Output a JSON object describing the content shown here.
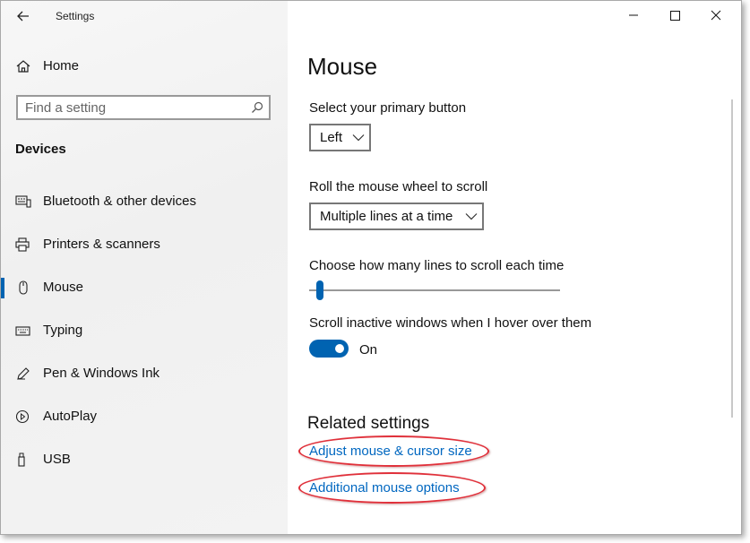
{
  "window": {
    "title": "Settings",
    "controls": {
      "minimize": "minimize-icon",
      "maximize": "maximize-icon",
      "close": "close-icon"
    }
  },
  "sidebar": {
    "home_label": "Home",
    "search": {
      "placeholder": "Find a setting",
      "value": ""
    },
    "section_heading": "Devices",
    "items": [
      {
        "label": "Bluetooth & other devices",
        "icon": "bluetooth-devices-icon",
        "selected": false
      },
      {
        "label": "Printers & scanners",
        "icon": "printer-icon",
        "selected": false
      },
      {
        "label": "Mouse",
        "icon": "mouse-icon",
        "selected": true
      },
      {
        "label": "Typing",
        "icon": "keyboard-icon",
        "selected": false
      },
      {
        "label": "Pen & Windows Ink",
        "icon": "pen-icon",
        "selected": false
      },
      {
        "label": "AutoPlay",
        "icon": "autoplay-icon",
        "selected": false
      },
      {
        "label": "USB",
        "icon": "usb-icon",
        "selected": false
      }
    ]
  },
  "main": {
    "title": "Mouse",
    "primary_button": {
      "label": "Select your primary button",
      "value": "Left"
    },
    "scroll_wheel": {
      "label": "Roll the mouse wheel to scroll",
      "value": "Multiple lines at a time"
    },
    "lines_to_scroll": {
      "label": "Choose how many lines to scroll each time",
      "slider_fraction": 0.03
    },
    "inactive_scroll": {
      "label": "Scroll inactive windows when I hover over them",
      "state": "On",
      "on": true
    },
    "related": {
      "heading": "Related settings",
      "links": [
        "Adjust mouse & cursor size",
        "Additional mouse options"
      ]
    }
  },
  "colors": {
    "accent": "#0063b1",
    "link": "#0067c0",
    "highlight": "#e0303a",
    "sidebar_bg": "#f2f2f2"
  }
}
